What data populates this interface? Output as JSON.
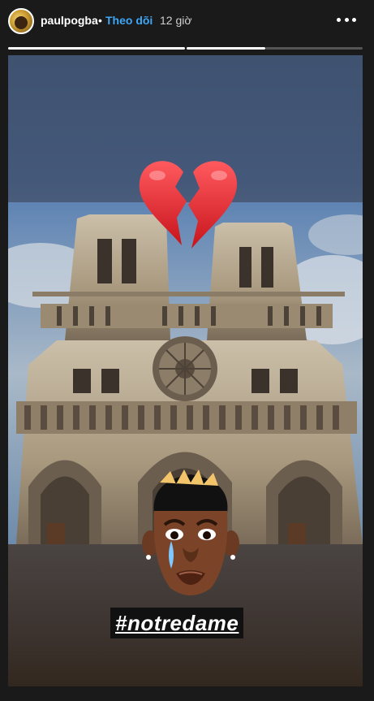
{
  "header": {
    "username": "paulpogba",
    "separator": "•",
    "follow_label": "Theo dõi",
    "time": "12 giờ"
  },
  "story": {
    "sticker_emoji": "broken-heart",
    "hashtag": "#notredame",
    "progress_segments": [
      {
        "state": "complete",
        "fill": 1.0
      },
      {
        "state": "active",
        "fill": 0.45
      }
    ]
  },
  "colors": {
    "accent": "#3ea6f5",
    "heart": "#e0242b",
    "story_top": "#44587a",
    "story_bottom": "#3d3430"
  }
}
